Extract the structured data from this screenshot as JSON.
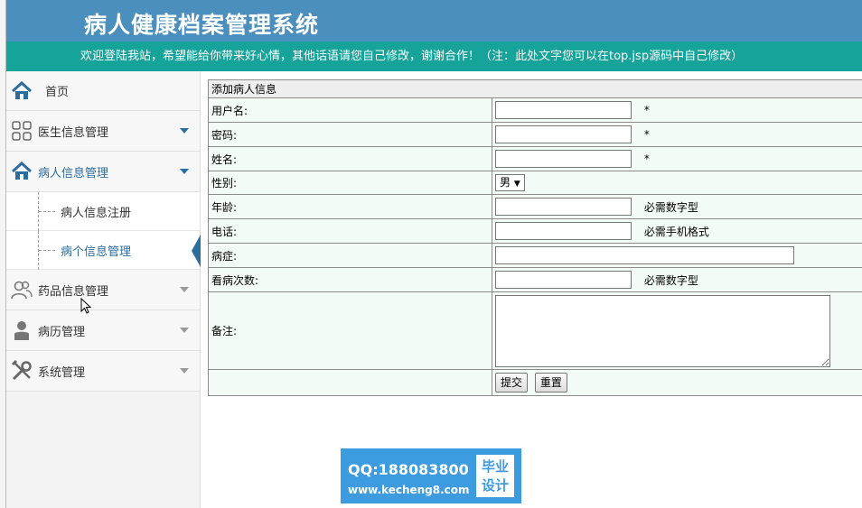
{
  "header": {
    "title": "病人健康档案管理系统",
    "welcome": "欢迎登陆我站，希望能给你带来好心情，其他话语请您自己修改，谢谢合作！（注：此处文字您可以在top.jsp源码中自己修改）"
  },
  "sidebar": {
    "home": "首页",
    "doctor": "医生信息管理",
    "patient": "病人信息管理",
    "patient_sub": [
      "病人信息注册",
      "病个信息管理"
    ],
    "medicine": "药品信息管理",
    "records": "病历管理",
    "system": "系统管理"
  },
  "form": {
    "title": "添加病人信息",
    "fields": {
      "username": {
        "label": "用户名:",
        "value": "",
        "mark": "*"
      },
      "password": {
        "label": "密码:",
        "value": "",
        "mark": "*"
      },
      "name": {
        "label": "姓名:",
        "value": "",
        "mark": "*"
      },
      "gender": {
        "label": "性别:",
        "value": "男"
      },
      "age": {
        "label": "年龄:",
        "value": "",
        "hint": "必需数字型"
      },
      "phone": {
        "label": "电话:",
        "value": "",
        "hint": "必需手机格式"
      },
      "disease": {
        "label": "病症:",
        "value": ""
      },
      "visits": {
        "label": "看病次数:",
        "value": "",
        "hint": "必需数字型"
      },
      "remark": {
        "label": "备注:",
        "value": ""
      }
    },
    "submit": "提交",
    "reset": "重置"
  },
  "watermark": {
    "qq": "QQ:188083800",
    "site": "www.kecheng8.com",
    "badge_top": "毕业",
    "badge_bottom": "设计"
  },
  "colors": {
    "header": "#4a8fbd",
    "welcome_bar": "#16a39a",
    "accent": "#2b6d9e",
    "form_bg": "#f3fbf6"
  }
}
